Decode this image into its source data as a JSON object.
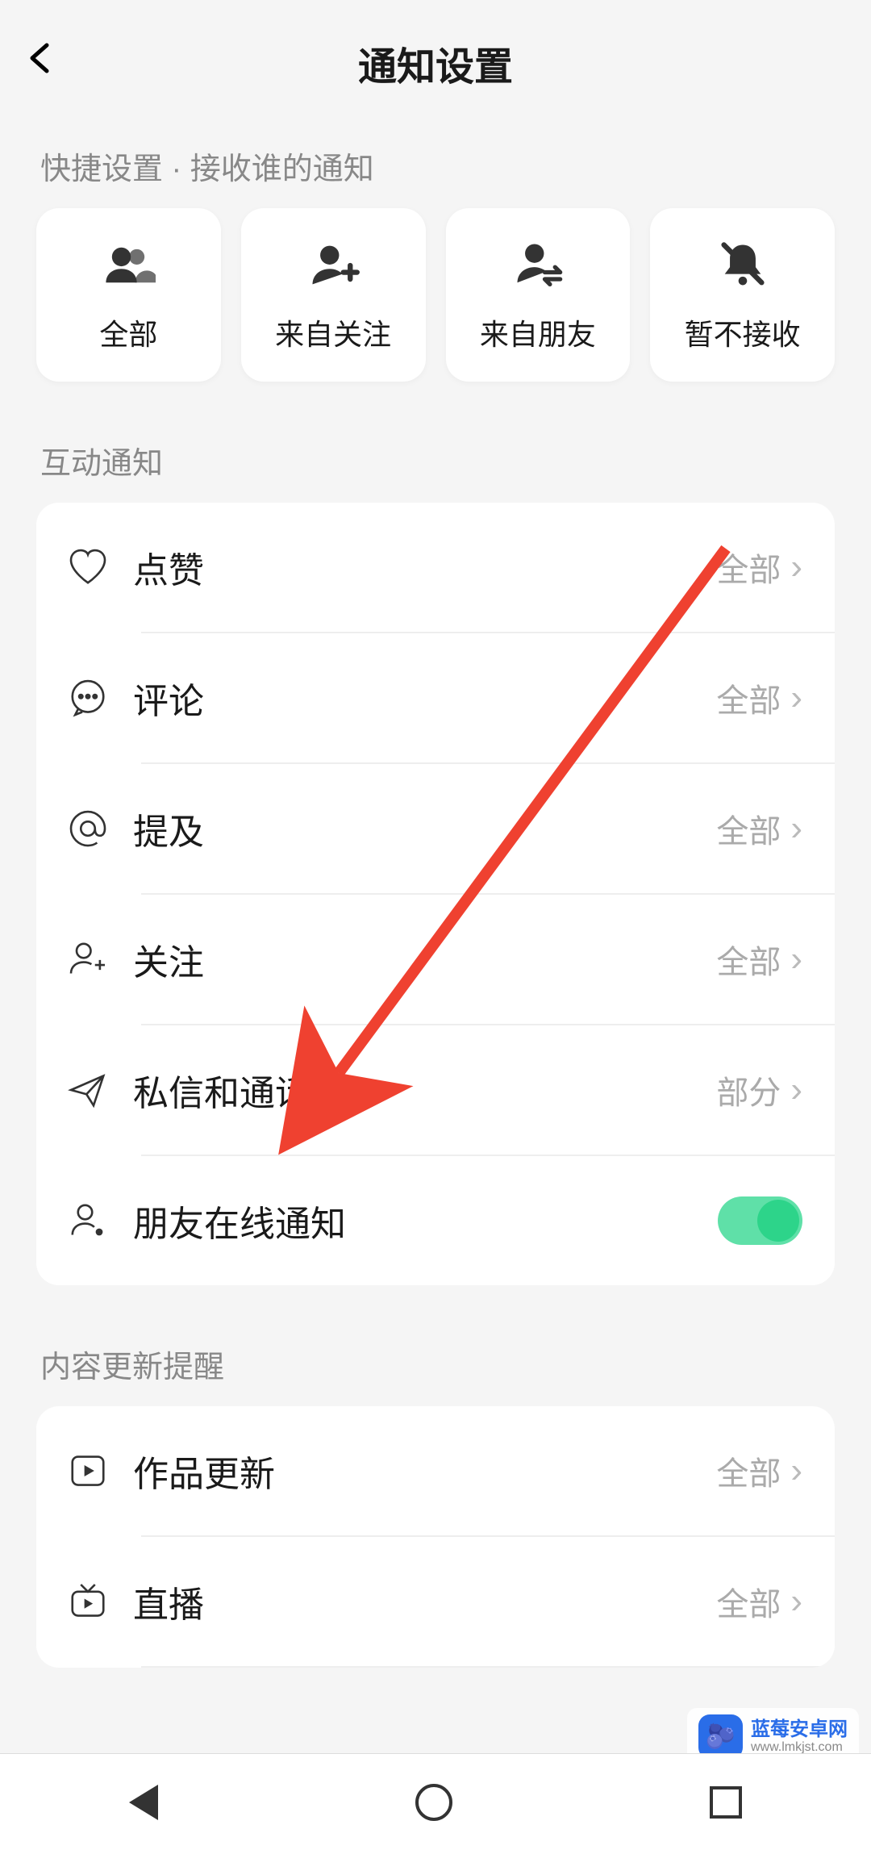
{
  "header": {
    "title": "通知设置"
  },
  "quick": {
    "label": "快捷设置 · 接收谁的通知",
    "items": [
      {
        "label": "全部"
      },
      {
        "label": "来自关注"
      },
      {
        "label": "来自朋友"
      },
      {
        "label": "暂不接收"
      }
    ]
  },
  "sections": {
    "interaction": {
      "title": "互动通知",
      "items": [
        {
          "label": "点赞",
          "value": "全部"
        },
        {
          "label": "评论",
          "value": "全部"
        },
        {
          "label": "提及",
          "value": "全部"
        },
        {
          "label": "关注",
          "value": "全部"
        },
        {
          "label": "私信和通话",
          "value": "部分"
        },
        {
          "label": "朋友在线通知",
          "toggle": true
        }
      ]
    },
    "content": {
      "title": "内容更新提醒",
      "items": [
        {
          "label": "作品更新",
          "value": "全部"
        },
        {
          "label": "直播",
          "value": "全部"
        }
      ]
    }
  },
  "watermark": {
    "line1": "蓝莓安卓网",
    "line2": "www.lmkjst.com"
  }
}
